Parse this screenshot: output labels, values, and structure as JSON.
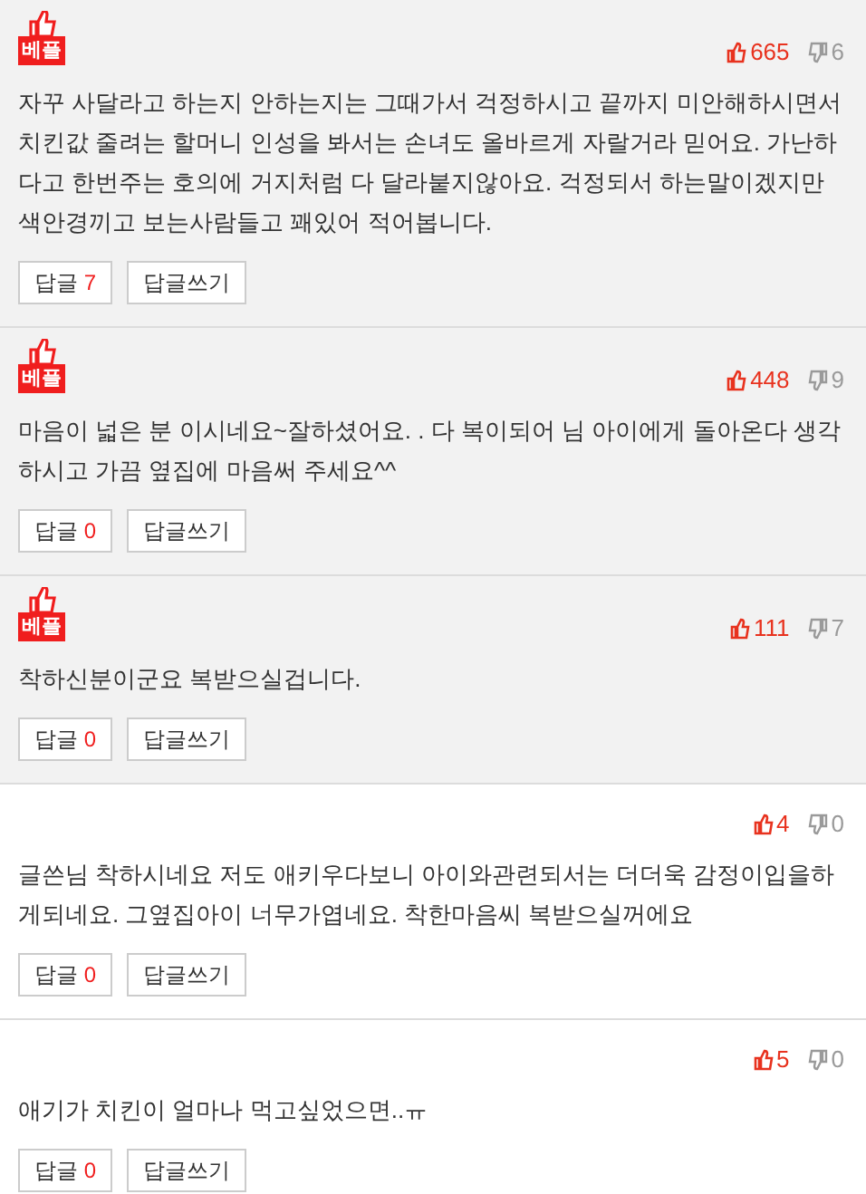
{
  "comments": [
    {
      "best": true,
      "badge": "베플",
      "likes": "665",
      "dislikes": "6",
      "text": "자꾸 사달라고 하는지 안하는지는 그때가서 걱정하시고 끝까지 미안해하시면서 치킨값 줄려는 할머니 인성을 봐서는 손녀도 올바르게 자랄거라 믿어요. 가난하다고 한번주는 호의에 거지처럼 다 달라붙지않아요. 걱정되서 하는말이겠지만 색안경끼고 보는사람들고 꽤있어 적어봅니다.",
      "reply_label": "답글",
      "reply_count": "7",
      "write_label": "답글쓰기"
    },
    {
      "best": true,
      "badge": "베플",
      "likes": "448",
      "dislikes": "9",
      "text": "마음이 넓은 분 이시네요~잘하셨어요. . 다 복이되어 님 아이에게 돌아온다 생각하시고 가끔 옆집에 마음써 주세요^^",
      "reply_label": "답글",
      "reply_count": "0",
      "write_label": "답글쓰기"
    },
    {
      "best": true,
      "badge": "베플",
      "likes": "111",
      "dislikes": "7",
      "text": "착하신분이군요 복받으실겁니다.",
      "reply_label": "답글",
      "reply_count": "0",
      "write_label": "답글쓰기"
    },
    {
      "best": false,
      "likes": "4",
      "dislikes": "0",
      "text": "글쓴님 착하시네요 저도 애키우다보니 아이와관련되서는 더더욱 감정이입을하게되네요. 그옆집아이 너무가엽네요. 착한마음씨 복받으실꺼에요",
      "reply_label": "답글",
      "reply_count": "0",
      "write_label": "답글쓰기"
    },
    {
      "best": false,
      "likes": "5",
      "dislikes": "0",
      "text": "애기가 치킨이 얼마나 먹고싶었으면..ㅠ",
      "reply_label": "답글",
      "reply_count": "0",
      "write_label": "답글쓰기"
    }
  ]
}
